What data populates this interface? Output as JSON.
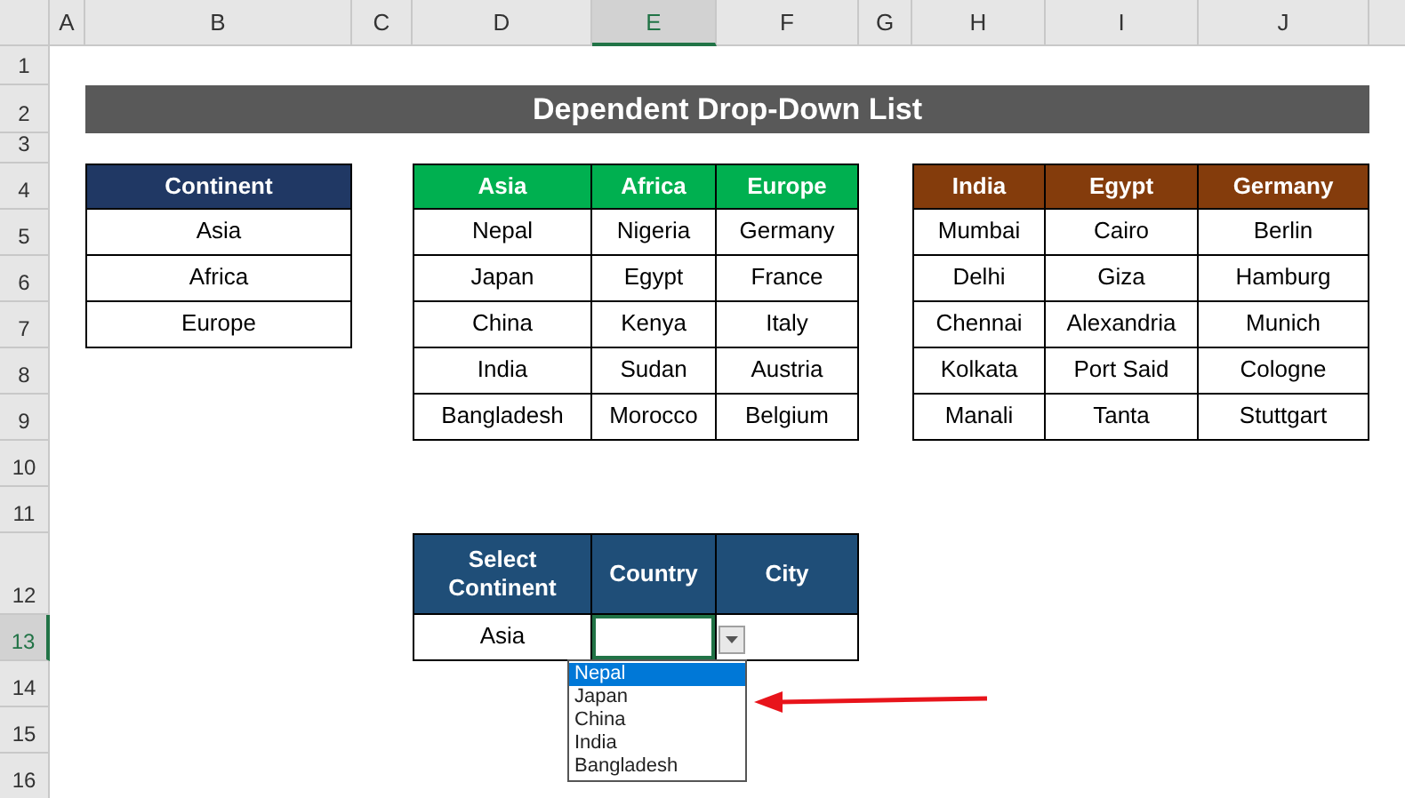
{
  "column_headers": [
    {
      "label": "A",
      "selected": false
    },
    {
      "label": "B",
      "selected": false
    },
    {
      "label": "C",
      "selected": false
    },
    {
      "label": "D",
      "selected": false
    },
    {
      "label": "E",
      "selected": true
    },
    {
      "label": "F",
      "selected": false
    },
    {
      "label": "G",
      "selected": false
    },
    {
      "label": "H",
      "selected": false
    },
    {
      "label": "I",
      "selected": false
    },
    {
      "label": "J",
      "selected": false
    }
  ],
  "row_headers": [
    {
      "label": "1",
      "selected": false
    },
    {
      "label": "2",
      "selected": false
    },
    {
      "label": "3",
      "selected": false
    },
    {
      "label": "4",
      "selected": false
    },
    {
      "label": "5",
      "selected": false
    },
    {
      "label": "6",
      "selected": false
    },
    {
      "label": "7",
      "selected": false
    },
    {
      "label": "8",
      "selected": false
    },
    {
      "label": "9",
      "selected": false
    },
    {
      "label": "10",
      "selected": false
    },
    {
      "label": "11",
      "selected": false
    },
    {
      "label": "12",
      "selected": false
    },
    {
      "label": "13",
      "selected": true
    },
    {
      "label": "14",
      "selected": false
    },
    {
      "label": "15",
      "selected": false
    },
    {
      "label": "16",
      "selected": false
    }
  ],
  "title": "Dependent Drop-Down List",
  "continent_table": {
    "header": "Continent",
    "rows": [
      "Asia",
      "Africa",
      "Europe"
    ]
  },
  "countries_table": {
    "columns": [
      {
        "header": "Asia",
        "cells": [
          "Nepal",
          "Japan",
          "China",
          "India",
          "Bangladesh"
        ]
      },
      {
        "header": "Africa",
        "cells": [
          "Nigeria",
          "Egypt",
          "Kenya",
          "Sudan",
          "Morocco"
        ]
      },
      {
        "header": "Europe",
        "cells": [
          "Germany",
          "France",
          "Italy",
          "Austria",
          "Belgium"
        ]
      }
    ]
  },
  "cities_table": {
    "columns": [
      {
        "header": "India",
        "cells": [
          "Mumbai",
          "Delhi",
          "Chennai",
          "Kolkata",
          "Manali"
        ]
      },
      {
        "header": "Egypt",
        "cells": [
          "Cairo",
          "Giza",
          "Alexandria",
          "Port Said",
          "Tanta"
        ]
      },
      {
        "header": "Germany",
        "cells": [
          "Berlin",
          "Hamburg",
          "Munich",
          "Cologne",
          "Stuttgart"
        ]
      }
    ]
  },
  "selector_table": {
    "headers": [
      "Select Continent",
      "Country",
      "City"
    ],
    "values": [
      {
        "text": "Asia",
        "active": false
      },
      {
        "active": true
      },
      {
        "active": false
      }
    ]
  },
  "dropdown": {
    "items": [
      {
        "label": "Nepal",
        "selected": true
      },
      {
        "label": "Japan",
        "selected": false
      },
      {
        "label": "China",
        "selected": false
      },
      {
        "label": "India",
        "selected": false
      },
      {
        "label": "Bangladesh",
        "selected": false
      }
    ]
  }
}
